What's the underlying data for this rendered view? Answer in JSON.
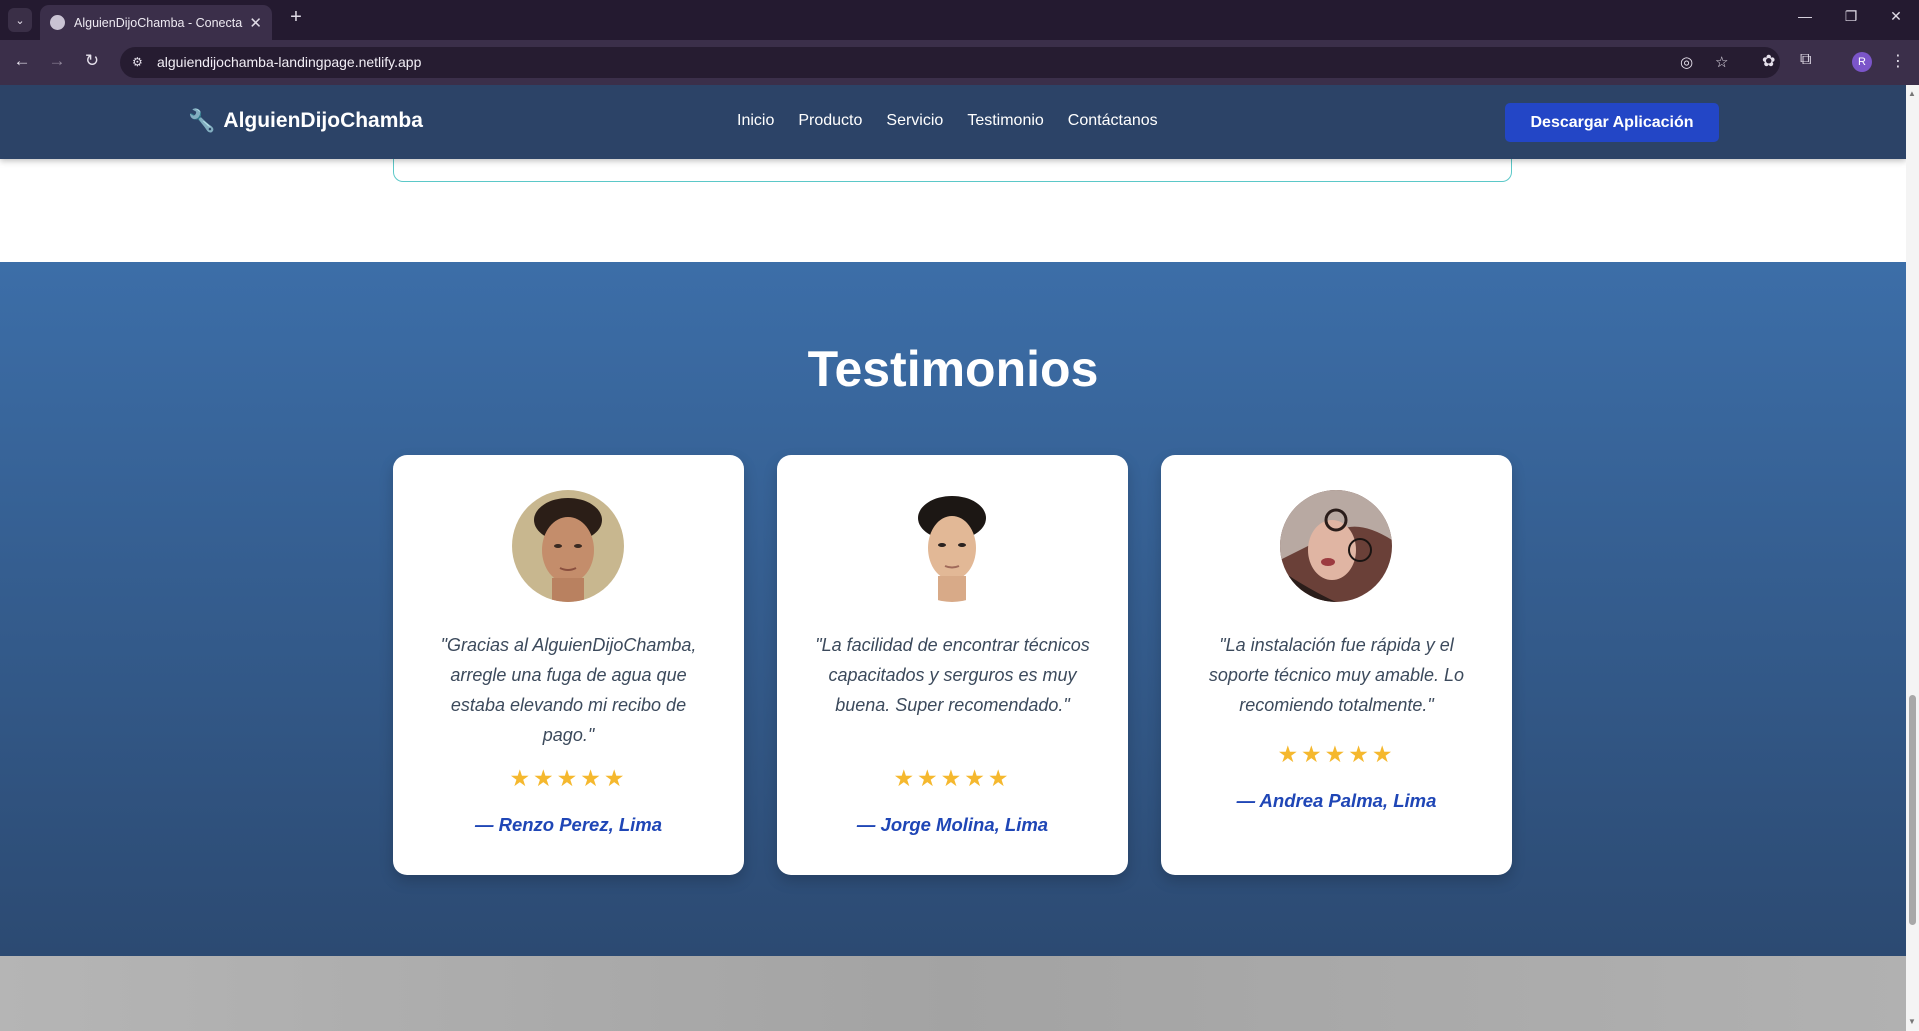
{
  "browser": {
    "tab_title": "AlguienDijoChamba - Conectan",
    "url": "alguiendijochamba-landingpage.netlify.app",
    "profile_initial": "R"
  },
  "header": {
    "brand": "AlguienDijoChamba",
    "brand_icon": "wrench-icon",
    "nav": [
      "Inicio",
      "Producto",
      "Servicio",
      "Testimonio",
      "Contáctanos"
    ],
    "cta": "Descargar Aplicación"
  },
  "testimonials": {
    "title": "Testimonios",
    "items": [
      {
        "quote": "\"Gracias al AlguienDijoChamba, arregle una fuga de agua que estaba elevando mi recibo de pago.\"",
        "rating": 5,
        "stars": "★★★★★",
        "author": "— Renzo Perez, Lima"
      },
      {
        "quote": "\"La facilidad de encontrar técnicos capacitados y serguros es muy buena. Super recomendado.\"",
        "rating": 5,
        "stars": "★★★★★",
        "author": "— Jorge Molina, Lima"
      },
      {
        "quote": "\"La instalación fue rápida y el soporte técnico muy amable. Lo recomiendo totalmente.\"",
        "rating": 5,
        "stars": "★★★★★",
        "author": "— Andrea Palma, Lima"
      }
    ]
  },
  "colors": {
    "header_bg": "#2c4367",
    "cta_bg": "#2346c6",
    "section_gradient_top": "#3c6ea8",
    "section_gradient_bottom": "#2c4a72",
    "star": "#f5b82e",
    "author": "#1f46b6"
  }
}
